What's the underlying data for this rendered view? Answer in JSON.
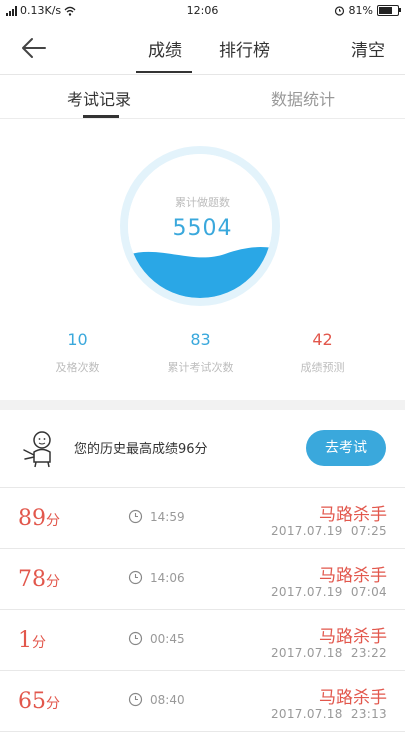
{
  "status": {
    "net_speed": "0.13K/s",
    "time": "12:06",
    "battery": "81%"
  },
  "nav": {
    "tabs": [
      "成绩",
      "排行榜"
    ],
    "clear_label": "清空"
  },
  "subtabs": [
    "考试记录",
    "数据统计"
  ],
  "gauge": {
    "label": "累计做题数",
    "value": "5504"
  },
  "stats": [
    {
      "num": "10",
      "label": "及格次数",
      "color": "#3aa8dc"
    },
    {
      "num": "83",
      "label": "累计考试次数",
      "color": "#3aa8dc"
    },
    {
      "num": "42",
      "label": "成绩预测",
      "color": "#e2574c"
    }
  ],
  "best": {
    "text": "您的历史最高成绩96分",
    "button": "去考试"
  },
  "records": [
    {
      "score": "89",
      "unit": "分",
      "duration": "14:59",
      "name": "马路杀手",
      "date": "2017.07.19  07:25"
    },
    {
      "score": "78",
      "unit": "分",
      "duration": "14:06",
      "name": "马路杀手",
      "date": "2017.07.19  07:04"
    },
    {
      "score": "1",
      "unit": "分",
      "duration": "00:45",
      "name": "马路杀手",
      "date": "2017.07.18  23:22"
    },
    {
      "score": "65",
      "unit": "分",
      "duration": "08:40",
      "name": "马路杀手",
      "date": "2017.07.18  23:13"
    }
  ],
  "colors": {
    "accent": "#3aa8dc",
    "score": "#e2574c"
  }
}
